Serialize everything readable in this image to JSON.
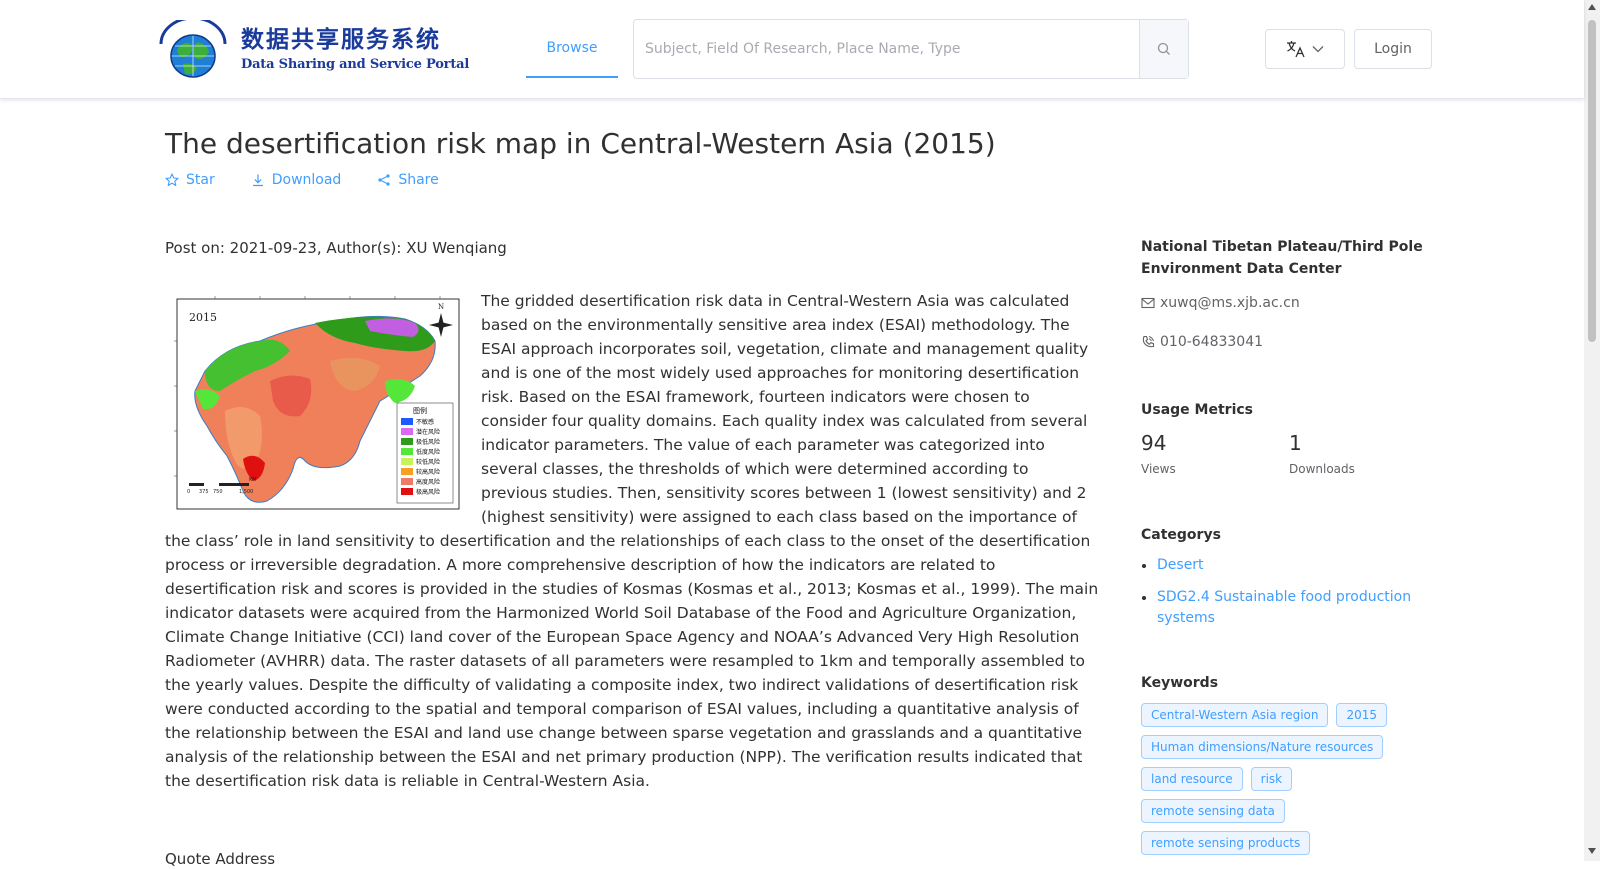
{
  "header": {
    "logo_cn": "数据共享服务系统",
    "logo_en": "Data Sharing and Service Portal",
    "nav_browse": "Browse",
    "search_placeholder": "Subject, Field Of Research, Place Name, Type",
    "search_icon": "search-icon",
    "language_icon": "translate-icon",
    "login_label": "Login"
  },
  "dataset": {
    "title": "The desertification risk map in Central-Western Asia (2015)",
    "actions": {
      "star": "Star",
      "download": "Download",
      "share": "Share"
    },
    "post_meta": "Post on: 2021-09-23, Author(s): XU Wenqiang",
    "description": "The gridded desertification risk data in Central-Western Asia was calculated based on the environmentally sensitive area index (ESAI) methodology. The ESAI approach incorporates soil, vegetation, climate and management quality and is one of the most widely used approaches for monitoring desertification risk. Based on the ESAI framework, fourteen indicators were chosen to consider four quality domains. Each quality index was calculated from several indicator parameters. The value of each parameter was categorized into several classes, the thresholds of which were determined according to previous studies. Then, sensitivity scores between 1 (lowest sensitivity) and 2 (highest sensitivity) were assigned to each class based on the importance of the class’ role in land sensitivity to desertification and the relationships of each class to the onset of the desertification process or irreversible degradation. A more comprehensive description of how the indicators are related to desertification risk and scores is provided in the studies of Kosmas (Kosmas et al., 2013; Kosmas et al., 1999). The main indicator datasets were acquired from the Harmonized World Soil Database of the Food and Agriculture Organization, Climate Change Initiative (CCI) land cover of the European Space Agency and NOAA’s Advanced Very High Resolution Radiometer (AVHRR) data. The raster datasets of all parameters were resampled to 1km and temporally assembled to the yearly values. Despite the difficulty of validating a composite index, two indirect validations of desertification risk were conducted according to the spatial and temporal comparison of ESAI values, including a quantitative analysis of the relationship between the ESAI and land use change between sparse vegetation and grasslands and a quantitative analysis of the relationship between the ESAI and net primary production (NPP). The verification results indicated that the desertification risk data is reliable in Central-Western Asia.",
    "quote_heading": "Quote Address",
    "thumbnail": {
      "year": "2015",
      "legend_title": "图例",
      "legend": [
        {
          "label": "不敏感",
          "color": "#1e5bff"
        },
        {
          "label": "潜在风险",
          "color": "#d86bf0"
        },
        {
          "label": "极低风险",
          "color": "#2e9b1a"
        },
        {
          "label": "低度风险",
          "color": "#55e63a"
        },
        {
          "label": "较低风险",
          "color": "#c8f25a"
        },
        {
          "label": "较高风险",
          "color": "#f5a020"
        },
        {
          "label": "高度风险",
          "color": "#f07a6a"
        },
        {
          "label": "极高风险",
          "color": "#e01010"
        }
      ],
      "scale_label": "KM",
      "scale_ticks": [
        "0",
        "375",
        "750",
        "1,500"
      ]
    }
  },
  "sidebar": {
    "center_name": "National Tibetan Plateau/Third Pole Environment Data Center",
    "email": "xuwq@ms.xjb.ac.cn",
    "phone": "010-64833041",
    "usage_heading": "Usage Metrics",
    "views_value": "94",
    "views_label": "Views",
    "downloads_value": "1",
    "downloads_label": "Downloads",
    "categories_heading": "Categorys",
    "categories": [
      "Desert",
      "SDG2.4 Sustainable food production systems"
    ],
    "keywords_heading": "Keywords",
    "keywords": [
      "Central-Western Asia region",
      "2015",
      "Human dimensions/Nature resources",
      "land resource",
      "risk",
      "remote sensing data",
      "remote sensing products"
    ]
  }
}
